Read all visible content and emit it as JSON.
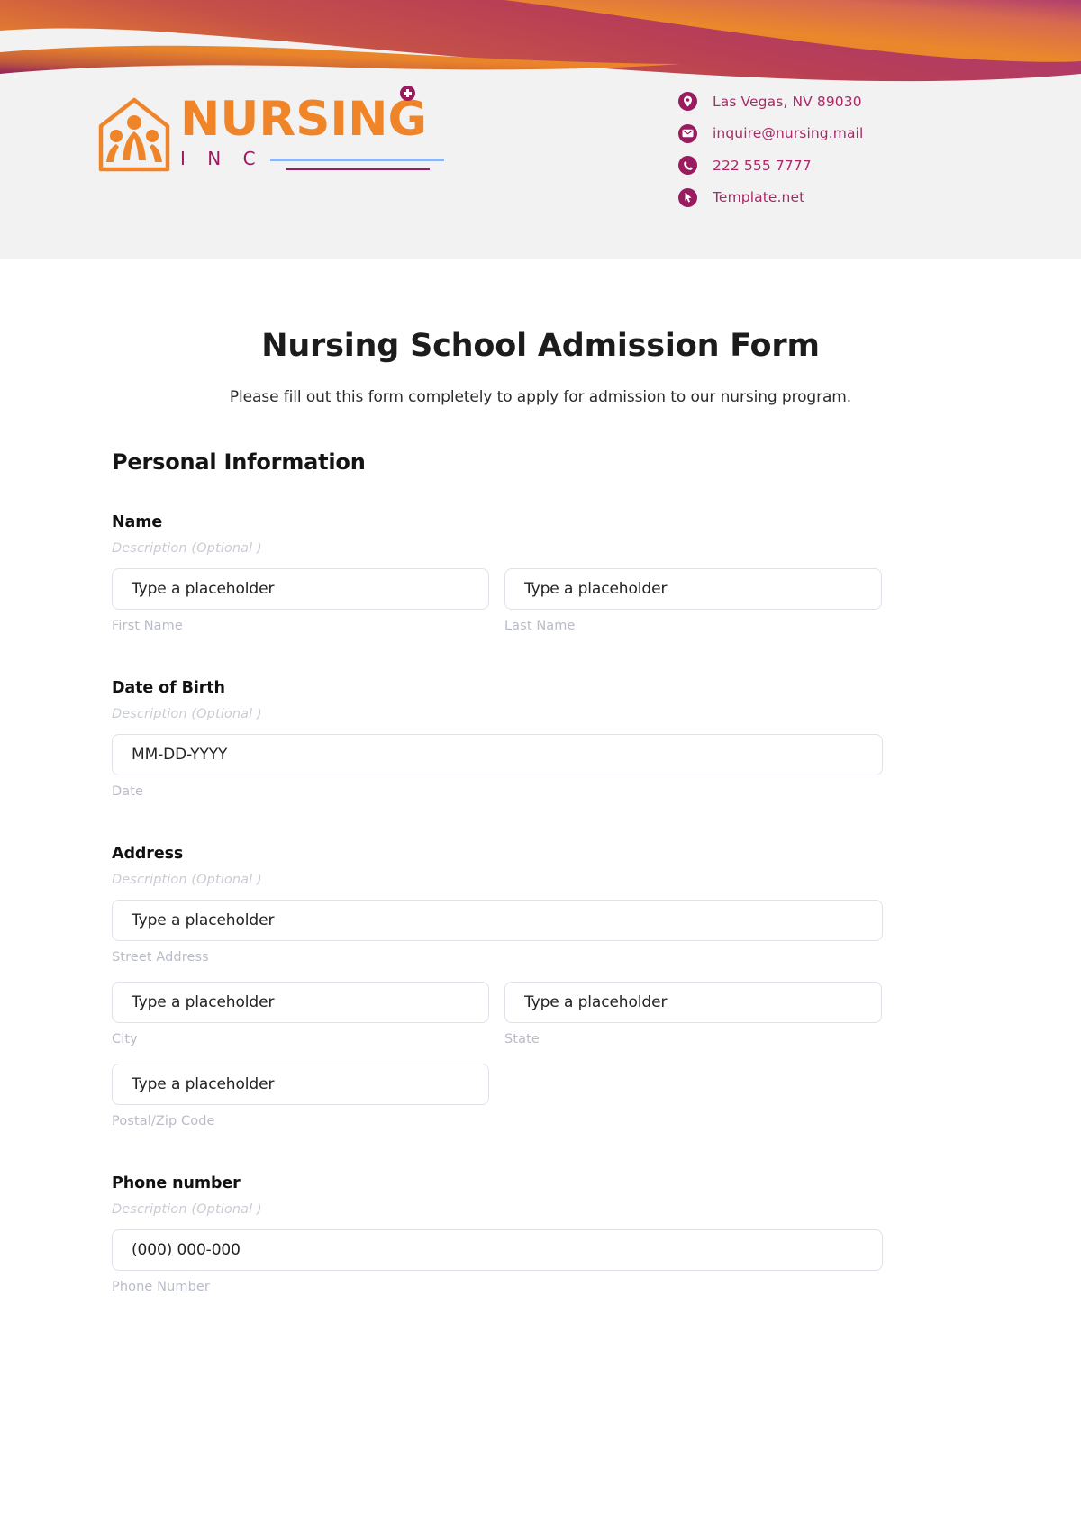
{
  "brand": {
    "logo_word": "NURSING",
    "logo_sub": "I N C",
    "logo_mark_name": "house-family-logo-icon",
    "orange": "#F08428",
    "purple": "#9B1B60",
    "blue_line": "#8FB4F2"
  },
  "contact": [
    {
      "icon": "location-pin-icon",
      "text": "Las Vegas, NV 89030"
    },
    {
      "icon": "envelope-icon",
      "text": "inquire@nursing.mail"
    },
    {
      "icon": "phone-icon",
      "text": "222 555 7777"
    },
    {
      "icon": "cursor-arrow-icon",
      "text": "Template.net"
    }
  ],
  "form": {
    "title": "Nursing School Admission Form",
    "subtitle": "Please fill out this form completely to apply for admission to our nursing program.",
    "section_heading": "Personal Information",
    "description_placeholder": "Description  (Optional )",
    "fields": {
      "name": {
        "label": "Name",
        "first": {
          "placeholder": "Type a placeholder",
          "sublabel": "First Name"
        },
        "last": {
          "placeholder": "Type a placeholder",
          "sublabel": "Last Name"
        }
      },
      "dob": {
        "label": "Date of Birth",
        "date": {
          "placeholder": "MM-DD-YYYY",
          "sublabel": "Date"
        }
      },
      "address": {
        "label": "Address",
        "street": {
          "placeholder": "Type a placeholder",
          "sublabel": "Street Address"
        },
        "city": {
          "placeholder": "Type a placeholder",
          "sublabel": "City"
        },
        "state": {
          "placeholder": "Type a placeholder",
          "sublabel": "State"
        },
        "zip": {
          "placeholder": "Type a placeholder",
          "sublabel": "Postal/Zip Code"
        }
      },
      "phone": {
        "label": "Phone number",
        "number": {
          "placeholder": "(000) 000-000",
          "sublabel": "Phone Number"
        }
      }
    }
  }
}
